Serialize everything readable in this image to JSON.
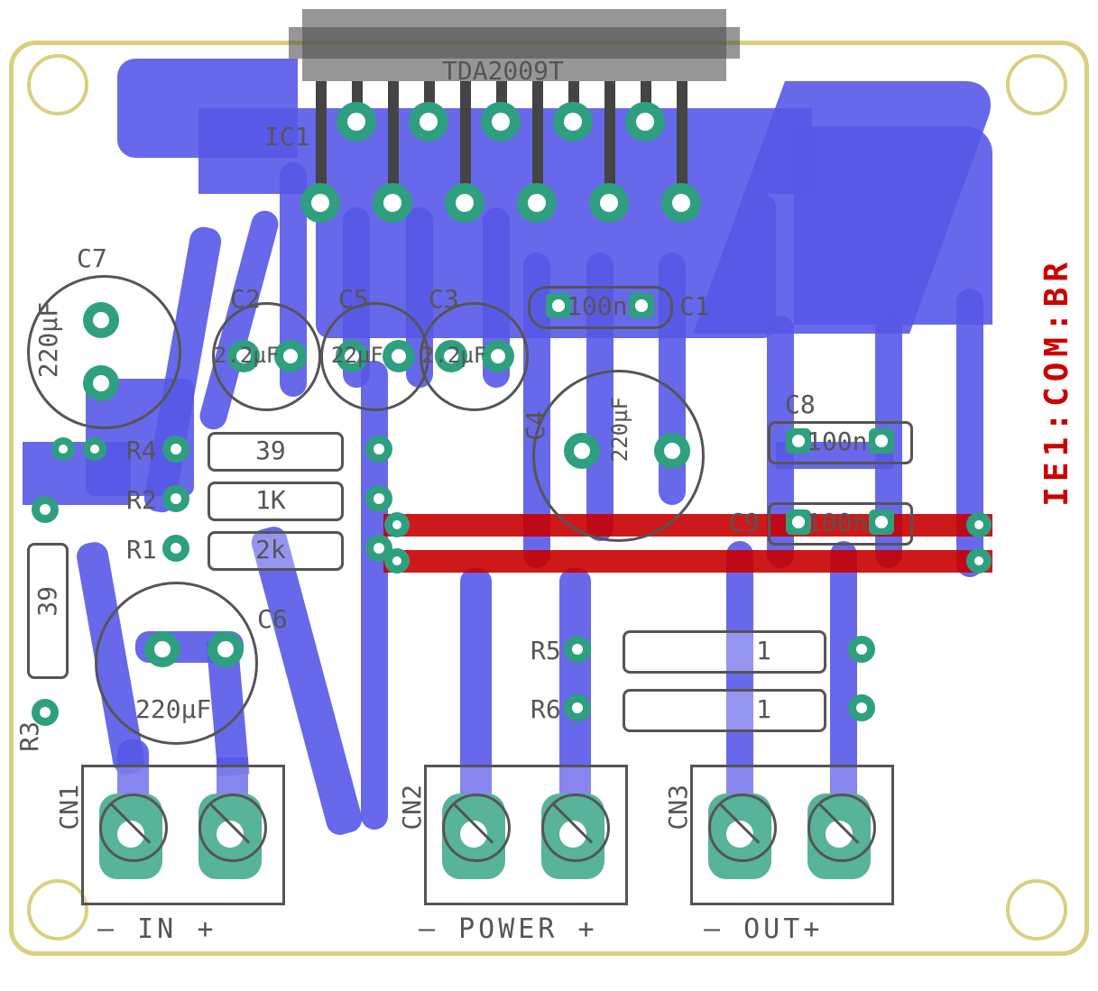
{
  "board": {
    "ic": {
      "designator": "IC1",
      "value": "TDA2009T"
    },
    "capacitors": {
      "C1": {
        "designator": "C1",
        "value": "100n"
      },
      "C2": {
        "designator": "C2",
        "value": "2.2µF"
      },
      "C3": {
        "designator": "C3",
        "value": "2.2µF"
      },
      "C4": {
        "designator": "C4",
        "value": "220µF"
      },
      "C5": {
        "designator": "C5",
        "value": "22µF"
      },
      "C6": {
        "designator": "C6",
        "value": "220µF"
      },
      "C7": {
        "designator": "C7",
        "value": "220µF"
      },
      "C8": {
        "designator": "C8",
        "value": "100n"
      },
      "C9": {
        "designator": "C9",
        "value": "100n"
      }
    },
    "resistors": {
      "R1": {
        "designator": "R1",
        "value": "2k"
      },
      "R2": {
        "designator": "R2",
        "value": "1K"
      },
      "R3": {
        "designator": "R3",
        "value": "39"
      },
      "R4": {
        "designator": "R4",
        "value": "39"
      },
      "R5": {
        "designator": "R5",
        "value": "1"
      },
      "R6": {
        "designator": "R6",
        "value": "1"
      }
    },
    "connectors": {
      "CN1": {
        "designator": "CN1",
        "label": "IN",
        "polarity_left": "–",
        "polarity_right": "+"
      },
      "CN2": {
        "designator": "CN2",
        "label": "POWER",
        "polarity_left": "–",
        "polarity_right": "+"
      },
      "CN3": {
        "designator": "CN3",
        "label": "OUT",
        "polarity_left": "–",
        "polarity_right": "+"
      }
    },
    "watermark": "IE1:COM:BR"
  }
}
